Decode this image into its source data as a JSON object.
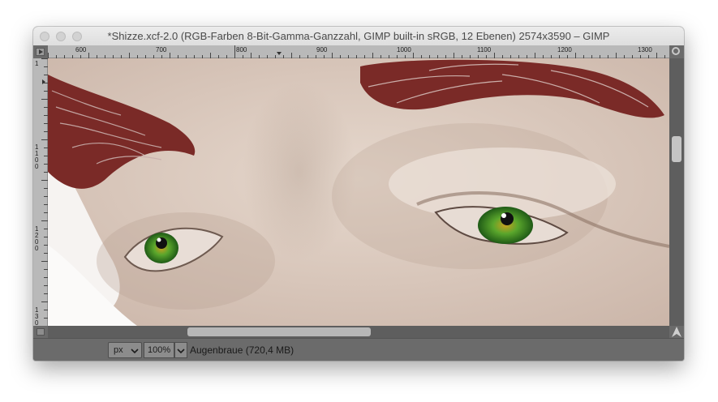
{
  "window": {
    "title": "*Shizze.xcf-2.0 (RGB-Farben 8-Bit-Gamma-Ganzzahl, GIMP built-in sRGB, 12 Ebenen) 2574x3590 – GIMP"
  },
  "rulers": {
    "horizontal_labels": [
      "600",
      "700",
      "800",
      "900",
      "1000",
      "1100",
      "1200",
      "1300"
    ],
    "vertical_labels": [
      "1",
      "1\n1\n0\n0",
      "1\n2\n0\n0",
      "1\n3\n0\n0"
    ]
  },
  "canvas": {
    "description_colors": {
      "skin": "#d6c3b6",
      "hair": "#7a2a26",
      "iris": "#3a9a2a"
    }
  },
  "statusbar": {
    "unit": "px",
    "zoom": "100%",
    "status": "Augenbraue (720,4 MB)"
  },
  "icons": {
    "corner": "ruler-corner-menu-icon",
    "zoom": "zoom-magnifier-icon",
    "quickmask": "quick-mask-icon",
    "navigate": "navigate-icon"
  }
}
